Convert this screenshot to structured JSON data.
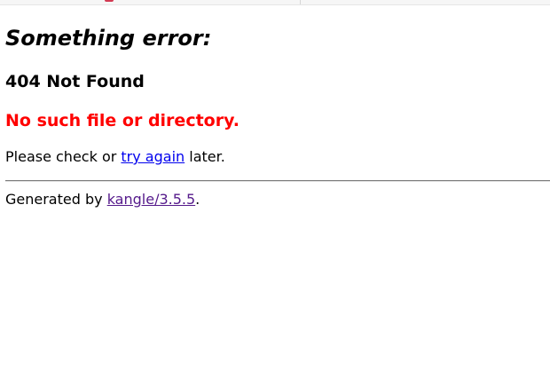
{
  "page": {
    "heading": "Something error:",
    "status": "404 Not Found",
    "error_message": "No such file or directory.",
    "help": {
      "prefix": "Please check or ",
      "link_label": "try again",
      "suffix": " later."
    },
    "footer": {
      "prefix": "Generated by ",
      "link_label": "kangle/3.5.5",
      "suffix": "."
    }
  },
  "colors": {
    "error": "#ff0000",
    "link": "#0000ee",
    "visited_link": "#551a8b",
    "divider": "#7a7a7a"
  }
}
